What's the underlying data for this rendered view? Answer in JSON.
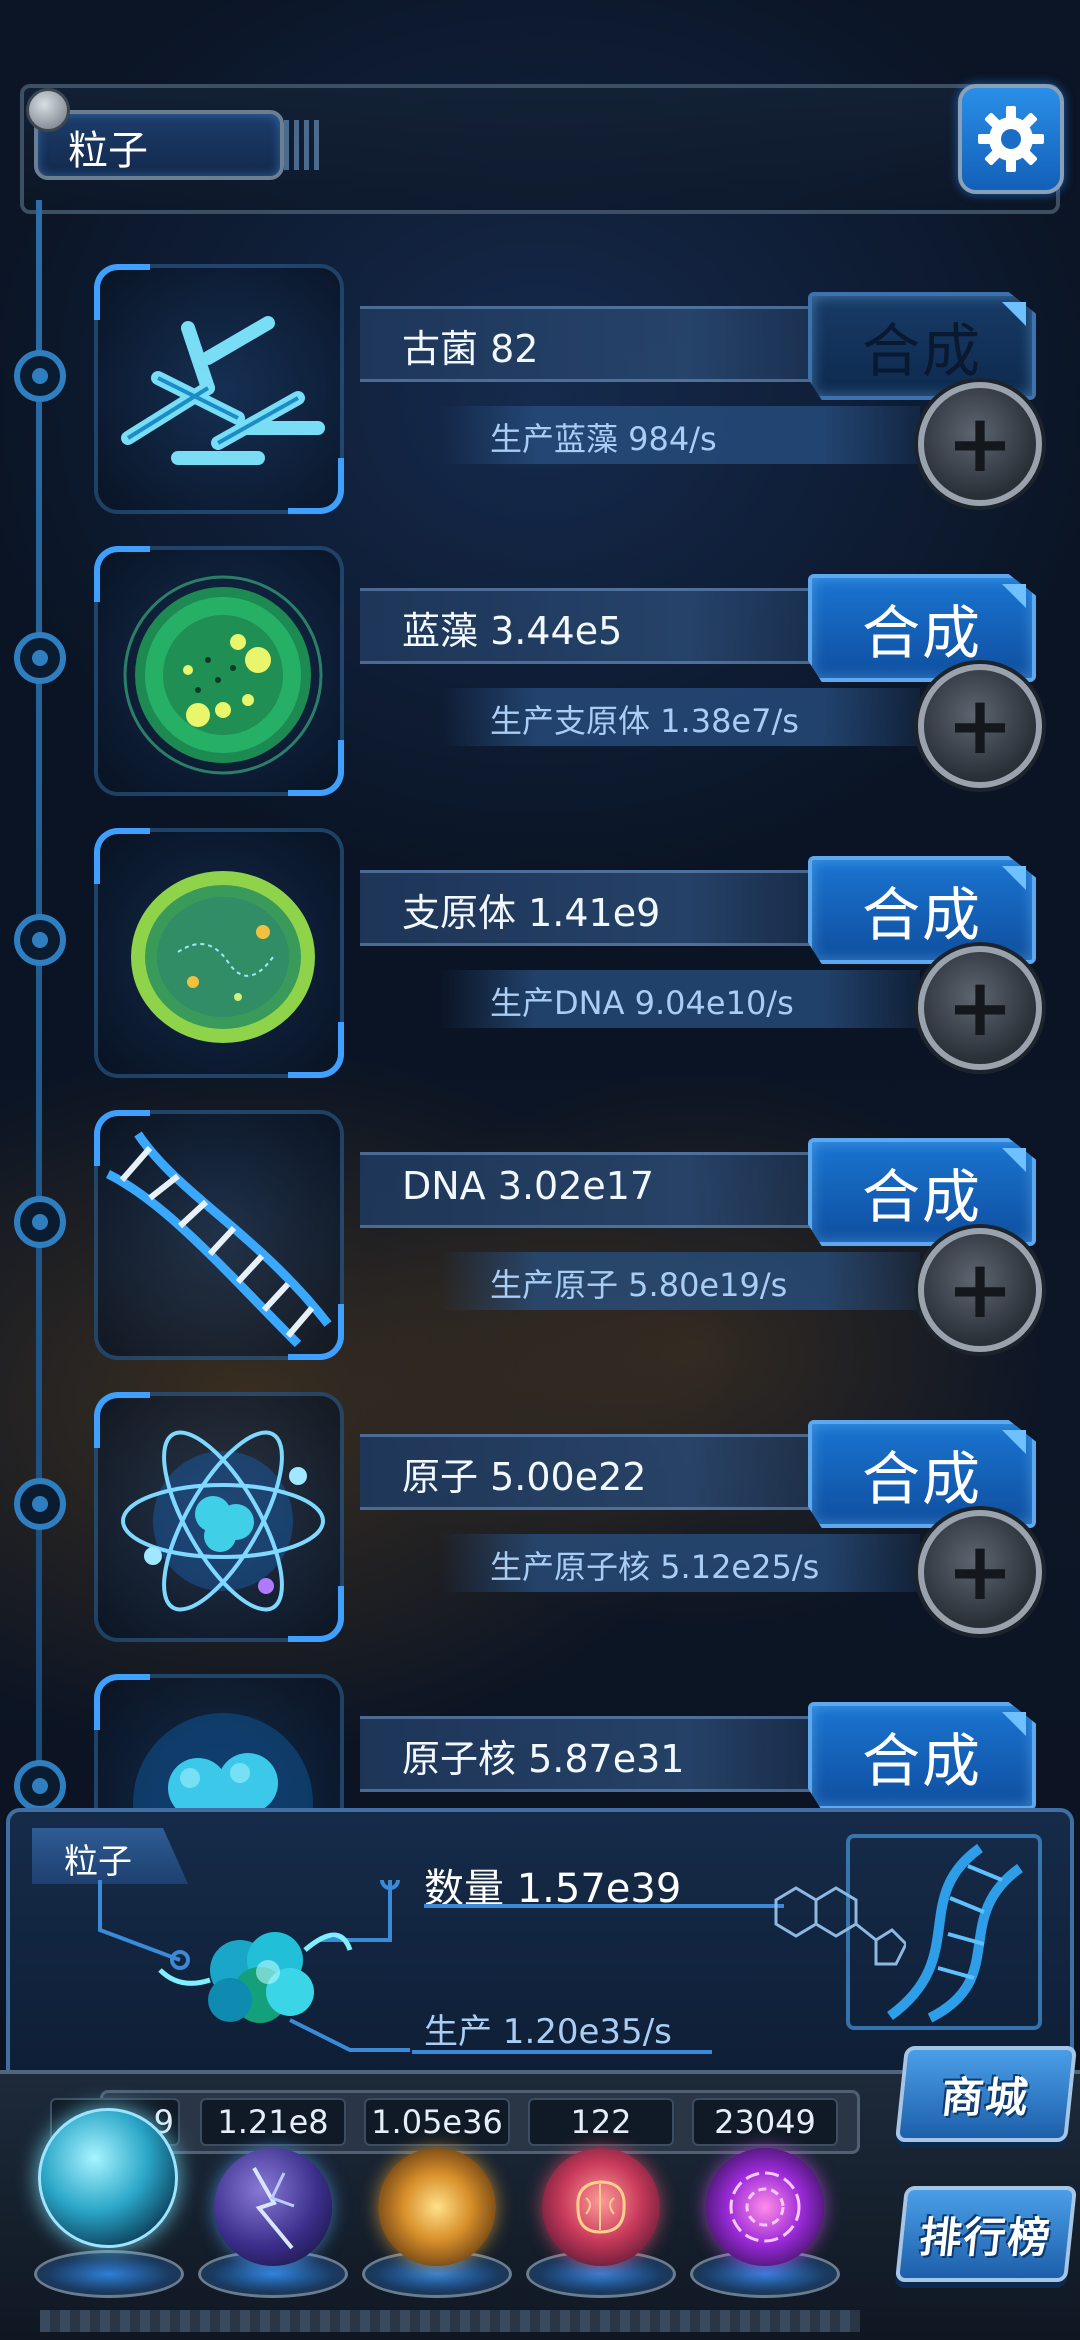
{
  "header": {
    "title": "粒子",
    "settings_icon": "gear-icon"
  },
  "items": [
    {
      "icon": "archaea-icon",
      "name": "古菌 82",
      "production": "生产蓝藻 984/s",
      "synth_label": "合成",
      "synth_enabled": false
    },
    {
      "icon": "cyanobacteria-icon",
      "name": "蓝藻 3.44e5",
      "production": "生产支原体 1.38e7/s",
      "synth_label": "合成",
      "synth_enabled": true
    },
    {
      "icon": "mycoplasma-icon",
      "name": "支原体 1.41e9",
      "production": "生产DNA 9.04e10/s",
      "synth_label": "合成",
      "synth_enabled": true
    },
    {
      "icon": "dna-icon",
      "name": "DNA 3.02e17",
      "production": "生产原子 5.80e19/s",
      "synth_label": "合成",
      "synth_enabled": true
    },
    {
      "icon": "atom-icon",
      "name": "原子 5.00e22",
      "production": "生产原子核 5.12e25/s",
      "synth_label": "合成",
      "synth_enabled": true
    },
    {
      "icon": "nucleus-icon",
      "name": "原子核 5.87e31",
      "production": "",
      "synth_label": "合成",
      "synth_enabled": true
    }
  ],
  "particle_panel": {
    "tag": "粒子",
    "count": "数量 1.57e39",
    "production": "生产 1.20e35/s"
  },
  "dock": {
    "resources": [
      {
        "value": "9",
        "icon": "particle-orb-icon"
      },
      {
        "value": "1.21e8",
        "icon": "lightning-orb-icon"
      },
      {
        "value": "1.05e36",
        "icon": "galaxy-orb-icon"
      },
      {
        "value": "122",
        "icon": "brain-orb-icon"
      },
      {
        "value": "23049",
        "icon": "vortex-orb-icon"
      }
    ],
    "shop_label": "商城",
    "leaderboard_label": "排行榜"
  },
  "colors": {
    "accent": "#1a74d0",
    "frame": "#3fa0ff",
    "background": "#0b1526"
  }
}
